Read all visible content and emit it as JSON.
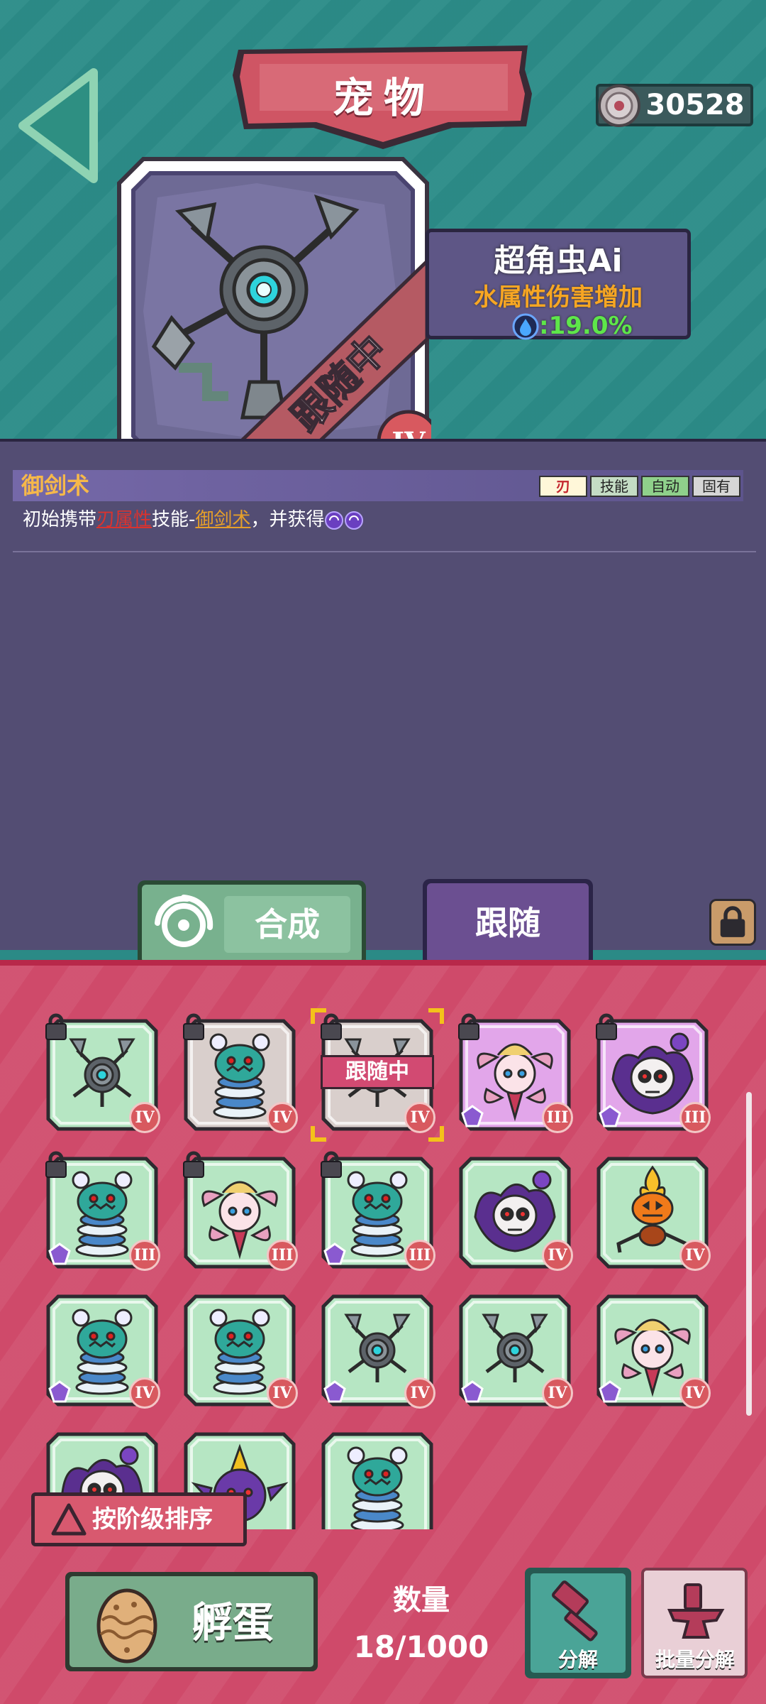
{
  "header": {
    "title": "宠物",
    "coins": "30528"
  },
  "pet": {
    "name": "超角虫Ai",
    "attribute": "水属性伤害增加",
    "value": ":19.0%",
    "status_ribbon": "跟随中",
    "tier": "IV"
  },
  "skill": {
    "name": "御剑术",
    "tags": [
      "刃",
      "技能",
      "自动",
      "固有"
    ],
    "desc_prefix": "初始携带",
    "desc_attr": "刃属性",
    "desc_mid": "技能-",
    "desc_skill": "御剑术",
    "desc_suffix": "，并获得"
  },
  "tabs": {
    "combine": "合成",
    "follow": "跟随"
  },
  "grid": {
    "following_label": "跟随中",
    "items": [
      {
        "pet": "robot",
        "tier": "IV",
        "locked": true,
        "bg": "#b6e6c3"
      },
      {
        "pet": "spring",
        "tier": "IV",
        "locked": true,
        "bg": "#d9cfcc"
      },
      {
        "pet": "robot",
        "tier": "IV",
        "locked": true,
        "bg": "#d9cfcc",
        "following": true
      },
      {
        "pet": "fairy",
        "tier": "III",
        "locked": true,
        "bg": "#e2a6ea",
        "gem": true
      },
      {
        "pet": "skull",
        "tier": "III",
        "locked": true,
        "bg": "#e2a6ea",
        "gem": true
      },
      {
        "pet": "spring",
        "tier": "III",
        "locked": true,
        "bg": "#b6e6c3",
        "gem": true
      },
      {
        "pet": "fairy",
        "tier": "III",
        "locked": true,
        "bg": "#b6e6c3"
      },
      {
        "pet": "spring",
        "tier": "III",
        "locked": true,
        "bg": "#b6e6c3",
        "gem": true
      },
      {
        "pet": "skull",
        "tier": "IV",
        "locked": false,
        "bg": "#b6e6c3"
      },
      {
        "pet": "pumpkin",
        "tier": "IV",
        "locked": false,
        "bg": "#b6e6c3"
      },
      {
        "pet": "spring",
        "tier": "IV",
        "locked": false,
        "bg": "#b6e6c3",
        "gem": true
      },
      {
        "pet": "spring",
        "tier": "IV",
        "locked": false,
        "bg": "#b6e6c3"
      },
      {
        "pet": "robot",
        "tier": "IV",
        "locked": false,
        "bg": "#b6e6c3",
        "gem": true
      },
      {
        "pet": "robot",
        "tier": "IV",
        "locked": false,
        "bg": "#b6e6c3",
        "gem": true
      },
      {
        "pet": "fairy",
        "tier": "IV",
        "locked": false,
        "bg": "#b6e6c3",
        "gem": true
      },
      {
        "pet": "skull",
        "tier": "",
        "locked": false,
        "bg": "#b6e6c3"
      },
      {
        "pet": "imp",
        "tier": "",
        "locked": false,
        "bg": "#b6e6c3"
      },
      {
        "pet": "spring",
        "tier": "",
        "locked": false,
        "bg": "#b6e6c3"
      }
    ]
  },
  "bottom": {
    "sort_label": "按阶级排序",
    "hatch_label": "孵蛋",
    "count_label": "数量",
    "count_value": "18/1000",
    "decompose_label": "分解",
    "batch_label": "批量分解"
  }
}
